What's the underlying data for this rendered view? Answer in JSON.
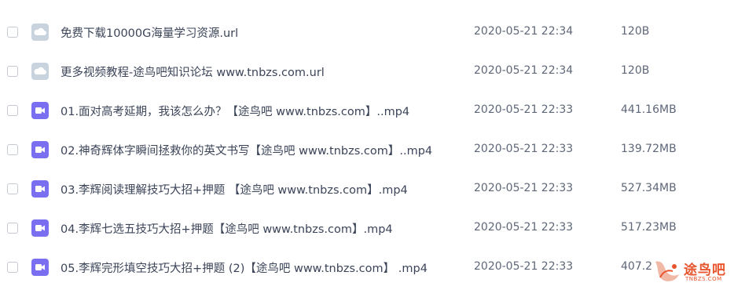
{
  "files": [
    {
      "type": "url",
      "icon": "cloud-file-icon",
      "name": "免费下载10000G海量学习资源.url",
      "date": "2020-05-21 22:34",
      "size": "120B"
    },
    {
      "type": "url",
      "icon": "cloud-file-icon",
      "name": "更多视频教程-途鸟吧知识论坛 www.tnbzs.com.url",
      "date": "2020-05-21 22:34",
      "size": "120B"
    },
    {
      "type": "mp4",
      "icon": "video-file-icon",
      "name": "01.面对高考延期，我该怎么办？【途鸟吧 www.tnbzs.com】..mp4",
      "date": "2020-05-21 22:33",
      "size": "441.16MB"
    },
    {
      "type": "mp4",
      "icon": "video-file-icon",
      "name": "02.神奇辉体字瞬间拯救你的英文书写【途鸟吧 www.tnbzs.com】..mp4",
      "date": "2020-05-21 22:33",
      "size": "139.72MB"
    },
    {
      "type": "mp4",
      "icon": "video-file-icon",
      "name": "03.李辉阅读理解技巧大招+押题 【途鸟吧 www.tnbzs.com】.mp4",
      "date": "2020-05-21 22:33",
      "size": "527.34MB"
    },
    {
      "type": "mp4",
      "icon": "video-file-icon",
      "name": "04.李辉七选五技巧大招+押题【途鸟吧 www.tnbzs.com】.mp4",
      "date": "2020-05-21 22:33",
      "size": "517.23MB"
    },
    {
      "type": "mp4",
      "icon": "video-file-icon",
      "name": "05.李辉完形填空技巧大招+押题 (2)【途鸟吧 www.tnbzs.com】 .mp4",
      "date": "2020-05-21 22:33",
      "size": "407.2"
    }
  ],
  "colors": {
    "cloud_icon": "#c8d3de",
    "video_icon": "#7a6ff0",
    "watermark": "#e8542c"
  },
  "watermark": {
    "text": "途鸟吧",
    "sub": "TNBZS.COM"
  }
}
